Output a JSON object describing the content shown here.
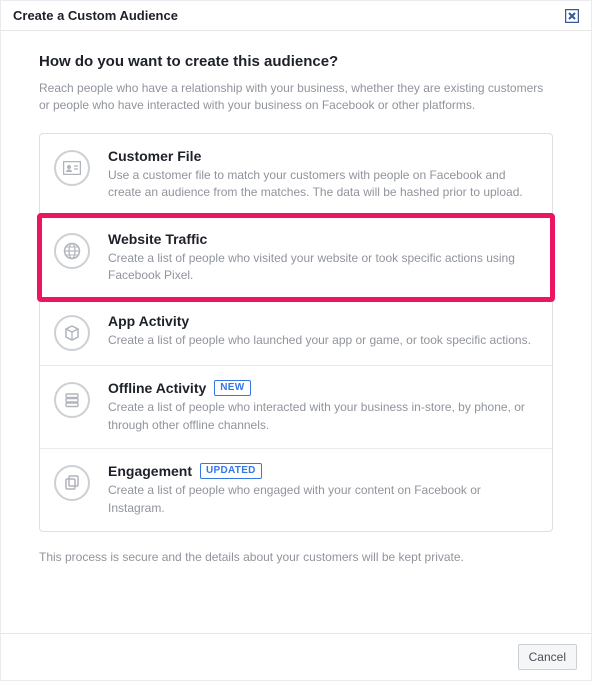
{
  "header": {
    "title": "Create a Custom Audience"
  },
  "body": {
    "question": "How do you want to create this audience?",
    "subtext": "Reach people who have a relationship with your business, whether they are existing customers or people who have interacted with your business on Facebook or other platforms."
  },
  "options": [
    {
      "icon": "id-card-icon",
      "title": "Customer File",
      "badge": "",
      "desc": "Use a customer file to match your customers with people on Facebook and create an audience from the matches. The data will be hashed prior to upload."
    },
    {
      "icon": "globe-icon",
      "title": "Website Traffic",
      "badge": "",
      "desc": "Create a list of people who visited your website or took specific actions using Facebook Pixel."
    },
    {
      "icon": "cube-icon",
      "title": "App Activity",
      "badge": "",
      "desc": "Create a list of people who launched your app or game, or took specific actions."
    },
    {
      "icon": "stack-icon",
      "title": "Offline Activity",
      "badge": "NEW",
      "desc": "Create a list of people who interacted with your business in-store, by phone, or through other offline channels."
    },
    {
      "icon": "copy-icon",
      "title": "Engagement",
      "badge": "UPDATED",
      "desc": "Create a list of people who engaged with your content on Facebook or Instagram."
    }
  ],
  "secure_note": "This process is secure and the details about your customers will be kept private.",
  "footer": {
    "cancel": "Cancel"
  }
}
